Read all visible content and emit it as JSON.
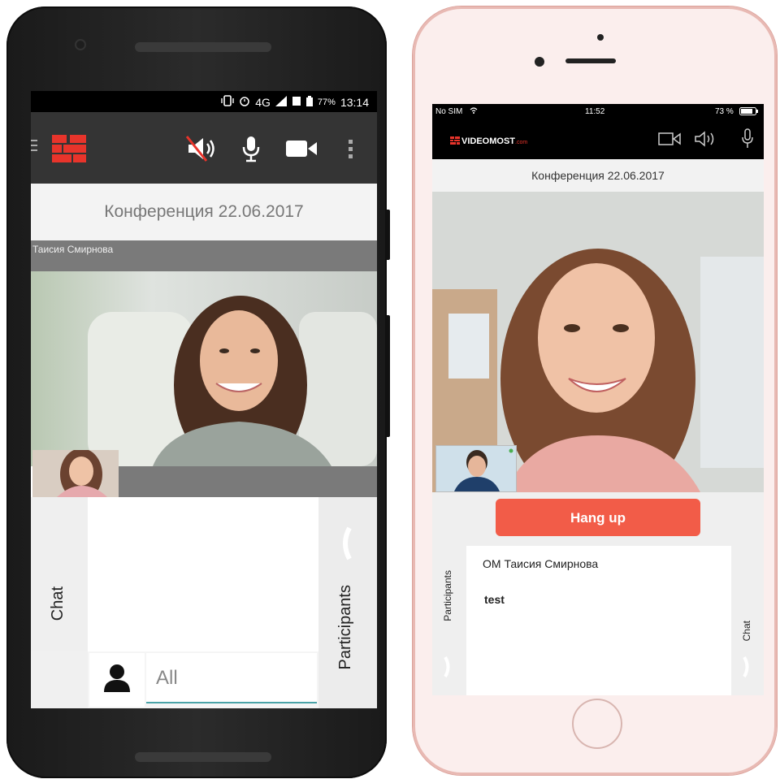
{
  "android": {
    "status_bar": {
      "network": "4G",
      "battery": "77%",
      "time": "13:14"
    },
    "toolbar": {
      "icons": [
        "menu-icon",
        "videomost-logo-icon",
        "speaker-muted-icon",
        "microphone-icon",
        "camera-icon",
        "more-vertical-icon"
      ]
    },
    "conference_title": "Конференция 22.06.2017",
    "speaker_name": "Таисия Смирнова",
    "chat_tab_label": "Chat",
    "participants_tab_label": "Participants",
    "recipient_value": "All"
  },
  "iphone": {
    "status_bar": {
      "carrier": "No SIM",
      "time": "11:52",
      "battery": "73 %"
    },
    "logo": {
      "brand": "VIDEOMOST",
      "suffix": ".com"
    },
    "toolbar": {
      "icons": [
        "camera-icon",
        "speaker-icon",
        "microphone-icon"
      ]
    },
    "conference_title": "Конференция 22.06.2017",
    "hangup_label": "Hang up",
    "chat_messages": [
      {
        "author": "ОМ Таисия Смирнова",
        "text": "test"
      }
    ],
    "participants_tab_label": "Participants",
    "chat_tab_label": "Chat"
  },
  "colors": {
    "accent_red": "#e8342b",
    "hangup_red": "#f25c48",
    "input_underline": "#4aa3a8"
  }
}
